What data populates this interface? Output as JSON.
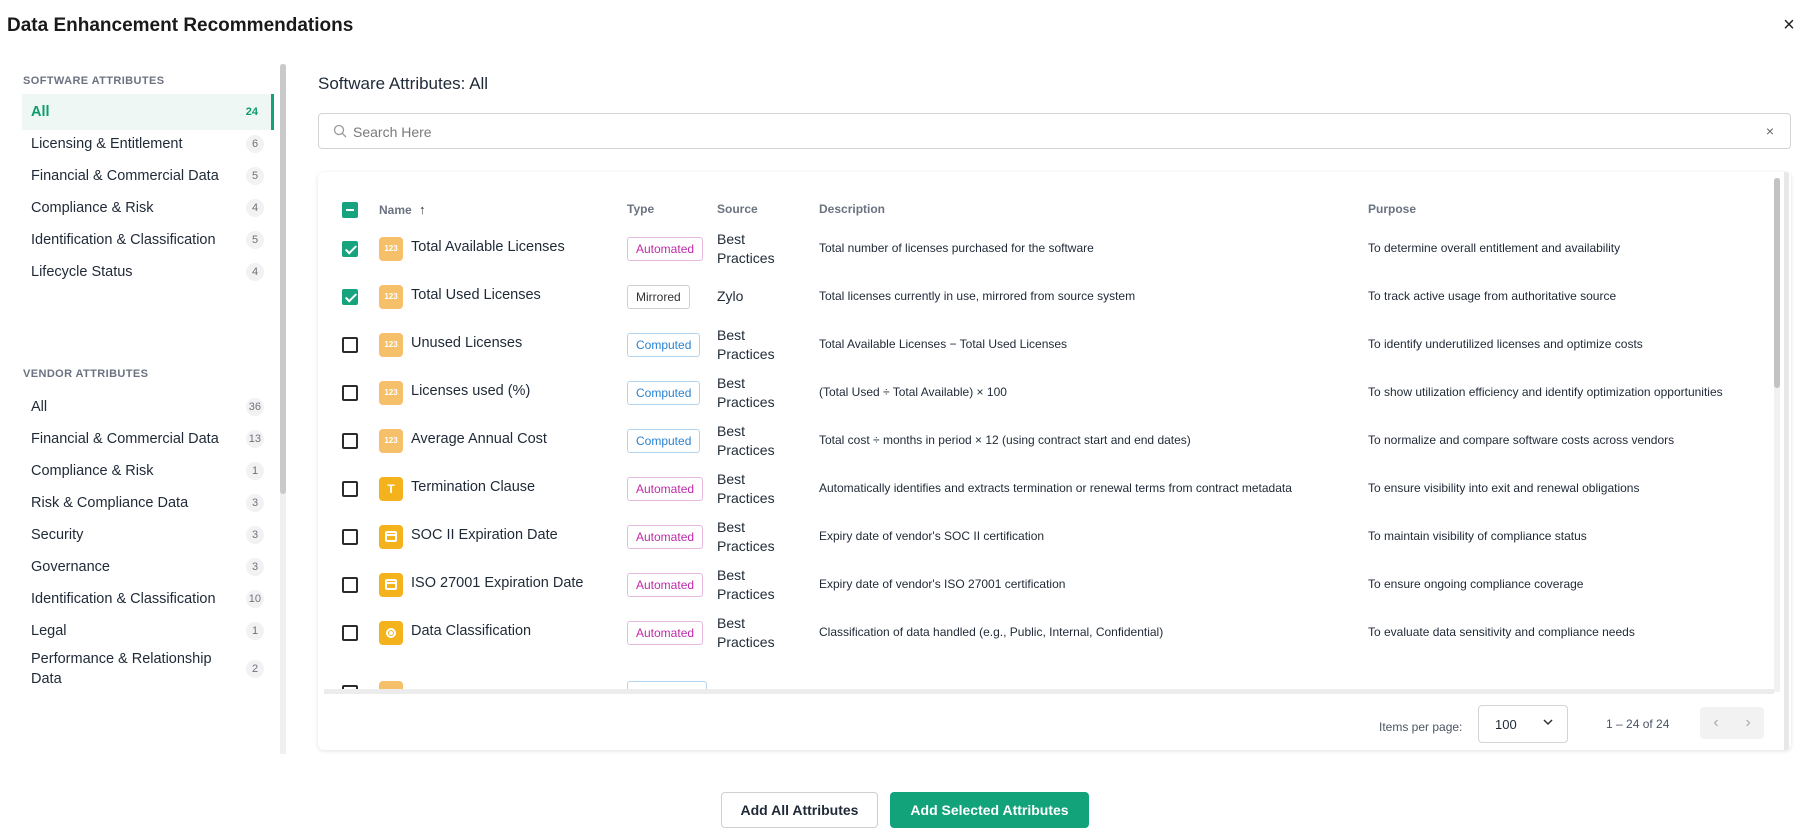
{
  "header": {
    "title": "Data Enhancement Recommendations",
    "close_icon": "×"
  },
  "sidebar": {
    "software_label": "SOFTWARE ATTRIBUTES",
    "software_items": [
      {
        "label": "All",
        "count": "24",
        "active": true
      },
      {
        "label": "Licensing & Entitlement",
        "count": "6"
      },
      {
        "label": "Financial & Commercial Data",
        "count": "5"
      },
      {
        "label": "Compliance & Risk",
        "count": "4"
      },
      {
        "label": "Identification & Classification",
        "count": "5"
      },
      {
        "label": "Lifecycle Status",
        "count": "4"
      }
    ],
    "vendor_label": "VENDOR ATTRIBUTES",
    "vendor_items": [
      {
        "label": "All",
        "count": "36"
      },
      {
        "label": "Financial & Commercial Data",
        "count": "13"
      },
      {
        "label": "Compliance & Risk",
        "count": "1"
      },
      {
        "label": "Risk & Compliance Data",
        "count": "3"
      },
      {
        "label": "Security",
        "count": "3"
      },
      {
        "label": "Governance",
        "count": "3"
      },
      {
        "label": "Identification & Classification",
        "count": "10"
      },
      {
        "label": "Legal",
        "count": "1"
      },
      {
        "label": "Performance & Relationship Data",
        "count": "2"
      }
    ]
  },
  "main": {
    "title": "Software Attributes: All",
    "search": {
      "placeholder": "Search Here",
      "value": "",
      "clear": "×"
    },
    "columns": {
      "name": "Name",
      "sort_arrow": "↑",
      "type": "Type",
      "source": "Source",
      "description": "Description",
      "purpose": "Purpose"
    },
    "rows": [
      {
        "checked": true,
        "icon": "number-icon",
        "icon_text": "123",
        "name": "Total Available Licenses",
        "type": "Automated",
        "source": "Best Practices",
        "description": "Total number of licenses purchased for the software",
        "purpose": "To determine overall entitlement and availability"
      },
      {
        "checked": true,
        "icon": "number-icon",
        "icon_text": "123",
        "name": "Total Used Licenses",
        "type": "Mirrored",
        "source": "Zylo",
        "description": "Total licenses currently in use, mirrored from source system",
        "purpose": "To track active usage from authoritative source"
      },
      {
        "checked": false,
        "icon": "number-icon",
        "icon_text": "123",
        "name": "Unused Licenses",
        "type": "Computed",
        "source": "Best Practices",
        "description": "Total Available Licenses − Total Used Licenses",
        "purpose": "To identify underutilized licenses and optimize costs"
      },
      {
        "checked": false,
        "icon": "number-icon",
        "icon_text": "123",
        "name": "Licenses used (%)",
        "type": "Computed",
        "source": "Best Practices",
        "description": "(Total Used ÷ Total Available) × 100",
        "purpose": "To show utilization efficiency and identify optimization opportunities"
      },
      {
        "checked": false,
        "icon": "number-icon",
        "icon_text": "123",
        "name": "Average Annual Cost",
        "type": "Computed",
        "source": "Best Practices",
        "description": "Total cost ÷ months in period × 12 (using contract start and end dates)",
        "purpose": "To normalize and compare software costs across vendors"
      },
      {
        "checked": false,
        "icon": "text-icon",
        "icon_text": "T",
        "name": "Termination Clause",
        "type": "Automated",
        "source": "Best Practices",
        "description": "Automatically identifies and extracts termination or renewal terms from contract metadata",
        "purpose": "To ensure visibility into exit and renewal obligations"
      },
      {
        "checked": false,
        "icon": "calendar-icon",
        "icon_text": "",
        "name": "SOC II Expiration Date",
        "type": "Automated",
        "source": "Best Practices",
        "description": "Expiry date of vendor's SOC II certification",
        "purpose": "To maintain visibility of compliance status"
      },
      {
        "checked": false,
        "icon": "calendar-icon",
        "icon_text": "",
        "name": "ISO 27001 Expiration Date",
        "type": "Automated",
        "source": "Best Practices",
        "description": "Expiry date of vendor's ISO 27001 certification",
        "purpose": "To ensure ongoing compliance coverage"
      },
      {
        "checked": false,
        "icon": "list-icon",
        "icon_text": "",
        "name": "Data Classification",
        "type": "Automated",
        "source": "Best Practices",
        "description": "Classification of data handled (e.g., Public, Internal, Confidential)",
        "purpose": "To evaluate data sensitivity and compliance needs"
      }
    ],
    "pagination": {
      "items_per_page_label": "Items per page:",
      "items_per_page": "100",
      "range": "1 – 24 of 24",
      "prev": "‹",
      "next": "›"
    }
  },
  "actions": {
    "add_all": "Add All Attributes",
    "add_selected": "Add Selected Attributes"
  },
  "colors": {
    "accent": "#12a37a",
    "automated": "#c02aa8",
    "computed": "#2b83d0",
    "icon": "#f4b31c"
  }
}
